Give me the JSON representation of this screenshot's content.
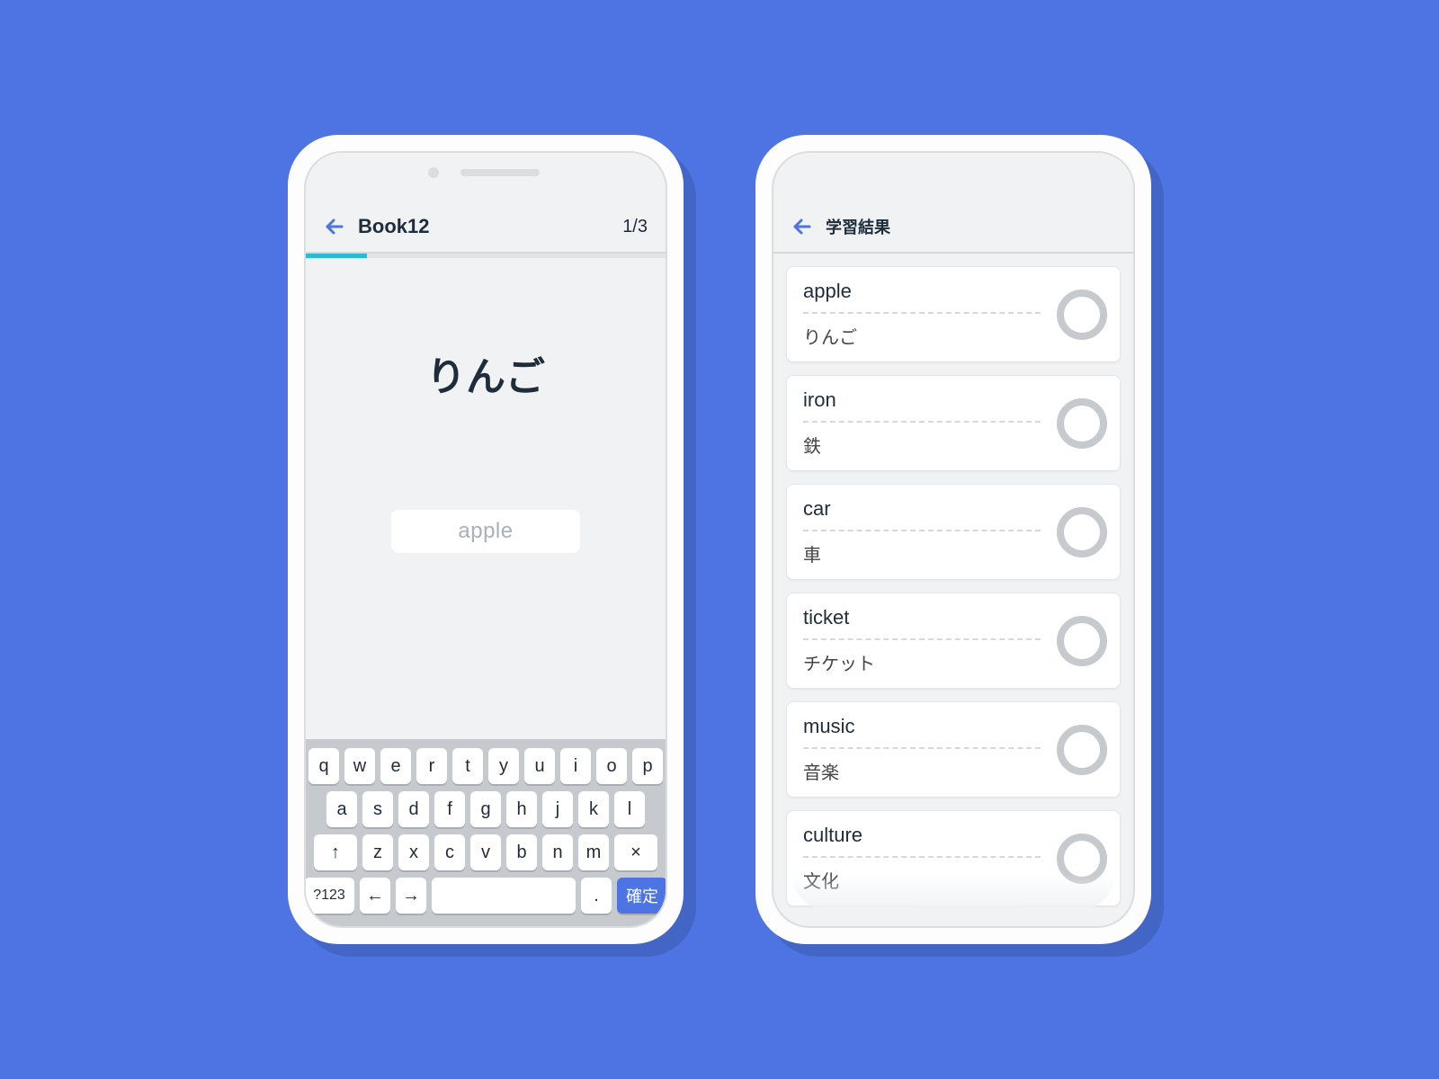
{
  "leftPhone": {
    "header": {
      "title": "Book12",
      "counter": "1/3"
    },
    "progressPercent": 17,
    "promptWord": "りんご",
    "answerPlaceholder": "apple",
    "keyboard": {
      "row1": [
        "q",
        "w",
        "e",
        "r",
        "t",
        "y",
        "u",
        "i",
        "o",
        "p"
      ],
      "row2": [
        "a",
        "s",
        "d",
        "f",
        "g",
        "h",
        "j",
        "k",
        "l"
      ],
      "row3": [
        "↑",
        "z",
        "x",
        "c",
        "v",
        "b",
        "n",
        "m",
        "×"
      ],
      "row4": {
        "switch": "?123",
        "left": "←",
        "right": "→",
        "period": ".",
        "enter": "確定"
      }
    }
  },
  "rightPhone": {
    "header": {
      "title": "学習結果"
    },
    "results": [
      {
        "en": "apple",
        "jp": "りんご"
      },
      {
        "en": "iron",
        "jp": "鉄"
      },
      {
        "en": "car",
        "jp": "車"
      },
      {
        "en": "ticket",
        "jp": "チケット"
      },
      {
        "en": "music",
        "jp": "音楽"
      },
      {
        "en": "culture",
        "jp": "文化"
      }
    ]
  }
}
